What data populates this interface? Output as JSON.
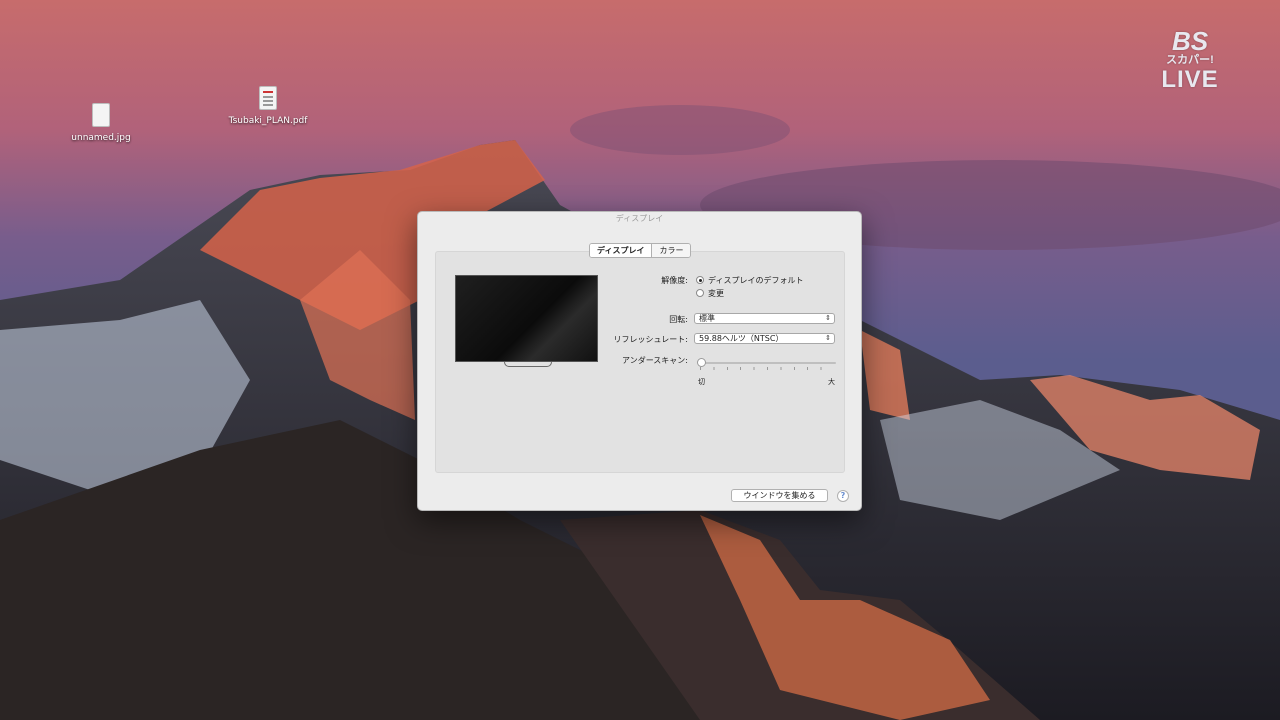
{
  "desktop": {
    "icons": [
      {
        "label": "unnamed.jpg",
        "icon": "image-file-icon"
      },
      {
        "label": "Tsubaki_PLAN.pdf",
        "icon": "pdf-file-icon"
      }
    ]
  },
  "overlay": {
    "logo_top": "BS",
    "logo_mid": "スカパー!",
    "logo_bottom": "LIVE"
  },
  "window": {
    "title": "ディスプレイ",
    "tabs": [
      {
        "label": "ディスプレイ",
        "active": true
      },
      {
        "label": "カラー",
        "active": false
      }
    ],
    "resolution": {
      "label": "解像度:",
      "options": [
        {
          "label": "ディスプレイのデフォルト",
          "selected": true
        },
        {
          "label": "変更",
          "selected": false
        }
      ]
    },
    "rotation": {
      "label": "回転:",
      "value": "標準"
    },
    "refresh_rate": {
      "label": "リフレッシュレート:",
      "value": "59.88ヘルツ（NTSC）"
    },
    "underscan": {
      "label": "アンダースキャン:",
      "min_label": "切",
      "max_label": "大",
      "value": 0
    },
    "buttons": {
      "gather_windows": "ウインドウを集める",
      "help": "?"
    }
  },
  "colors": {
    "window_bg": "#ececec",
    "panel_bg": "#e2e2e2",
    "help_blue": "#6a8fd0"
  }
}
